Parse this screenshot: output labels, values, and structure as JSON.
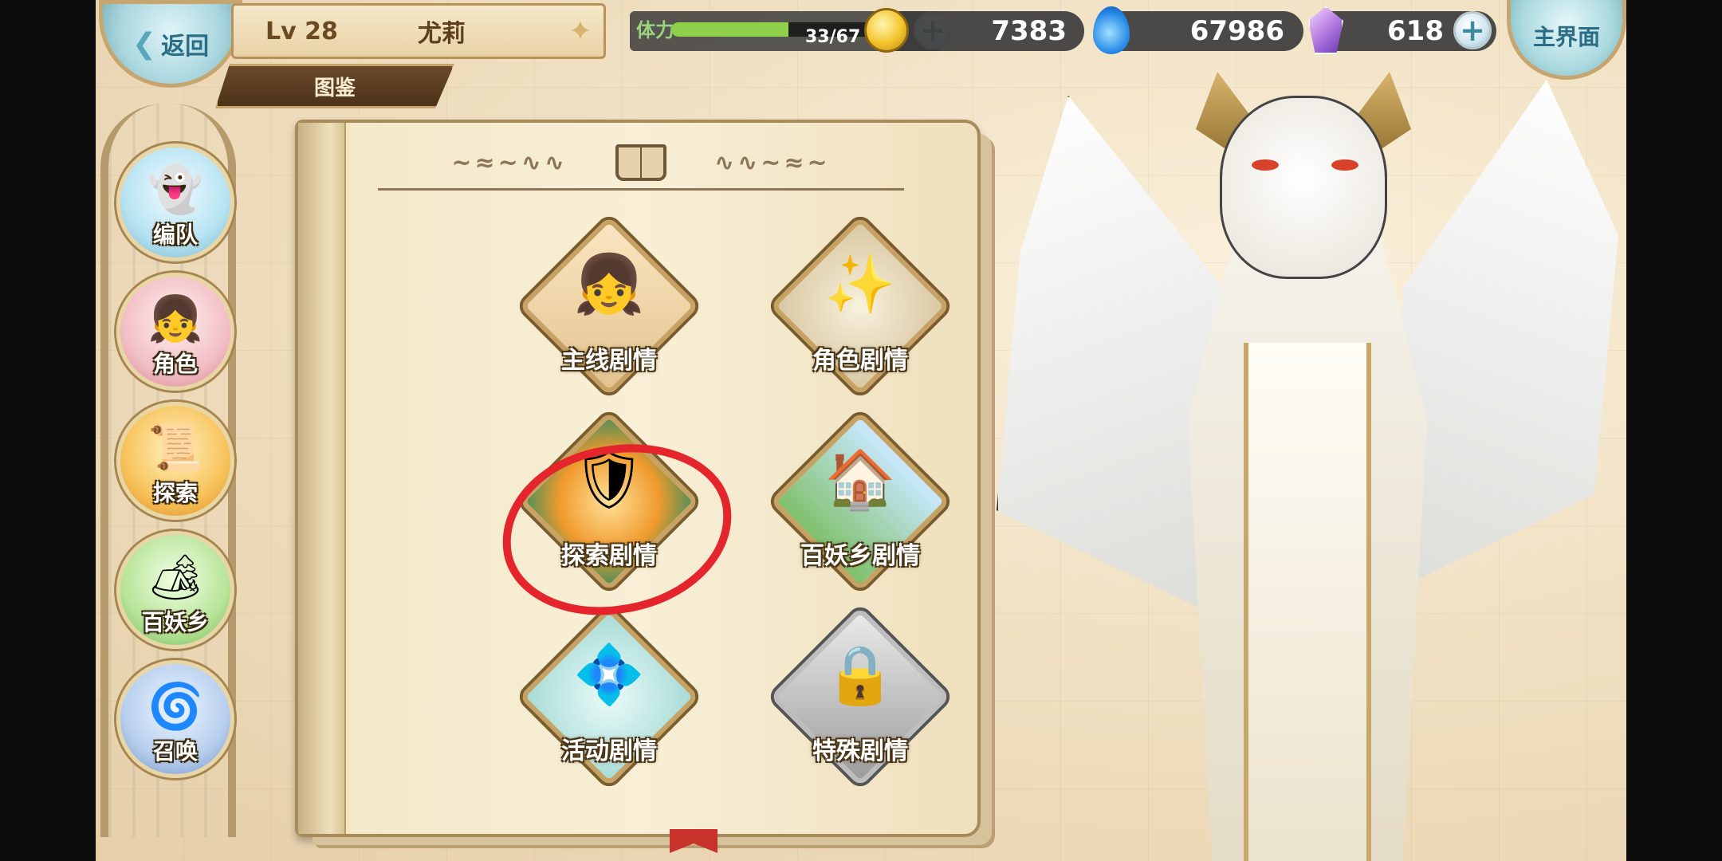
{
  "topbar": {
    "back_label": "返回",
    "level": "Lv 28",
    "player_name": "尤莉",
    "tab_label": "图鉴",
    "stamina_label": "体力",
    "stamina_current": 33,
    "stamina_max": 67,
    "stamina_fraction": 0.49,
    "stamina_text": "33/67",
    "gold": "7383",
    "gems": "67986",
    "crystals": "618",
    "home_label": "主界面"
  },
  "left_nav": [
    {
      "label": "编队",
      "icon": "team-icon",
      "glyph": "👻"
    },
    {
      "label": "角色",
      "icon": "character-icon",
      "glyph": "👧"
    },
    {
      "label": "探索",
      "icon": "explore-icon",
      "glyph": "📜"
    },
    {
      "label": "百妖乡",
      "icon": "village-icon",
      "glyph": "🏕"
    },
    {
      "label": "召唤",
      "icon": "summon-icon",
      "glyph": "🌀"
    }
  ],
  "book": {
    "stories": [
      {
        "label": "主线剧情",
        "icon": "main-story-icon",
        "glyph": "👧"
      },
      {
        "label": "角色剧情",
        "icon": "character-story-icon",
        "glyph": "✨"
      },
      {
        "label": "探索剧情",
        "icon": "explore-story-icon",
        "glyph": "🛡"
      },
      {
        "label": "百妖乡剧情",
        "icon": "village-story-icon",
        "glyph": "🏠"
      },
      {
        "label": "活动剧情",
        "icon": "event-story-icon",
        "glyph": "💠"
      },
      {
        "label": "特殊剧情",
        "icon": "special-story-icon",
        "glyph": "🔒"
      }
    ]
  },
  "colors": {
    "stamina_fill": "#8fd14b",
    "annotation_circle": "#e5252c",
    "panel_brown": "#5c3f1d"
  }
}
